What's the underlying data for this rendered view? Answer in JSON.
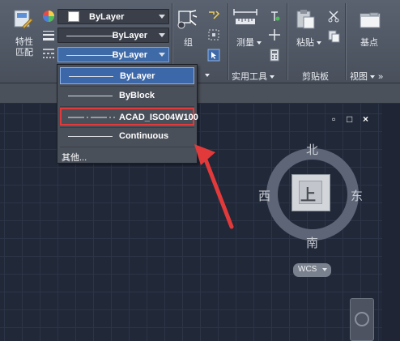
{
  "ribbon": {
    "match_props_label": [
      "特性",
      "匹配"
    ],
    "color_combo": "ByLayer",
    "lineweight_combo": "ByLayer",
    "linetype_combo": "ByLayer",
    "group_label": "组",
    "measure_label": "测量",
    "paste_label": "粘贴",
    "base_label": "基点",
    "panels": {
      "utilities": "实用工具",
      "clipboard": "剪贴板",
      "view": "视图"
    }
  },
  "linetype_dropdown": {
    "items": [
      "ByLayer",
      "ByBlock",
      "ACAD_ISO04W100",
      "Continuous"
    ],
    "selected": "ByLayer",
    "highlighted": "ACAD_ISO04W100",
    "other": "其他..."
  },
  "viewport": {
    "controls": [
      "▫",
      "□",
      "×"
    ]
  },
  "viewcube": {
    "face": "上",
    "north": "北",
    "south": "南",
    "east": "东",
    "west": "西",
    "wcs": "WCS"
  },
  "colors": {
    "highlight_border": "#e23a3a",
    "selection": "#3c67a8",
    "arrow": "#e23a3a"
  }
}
